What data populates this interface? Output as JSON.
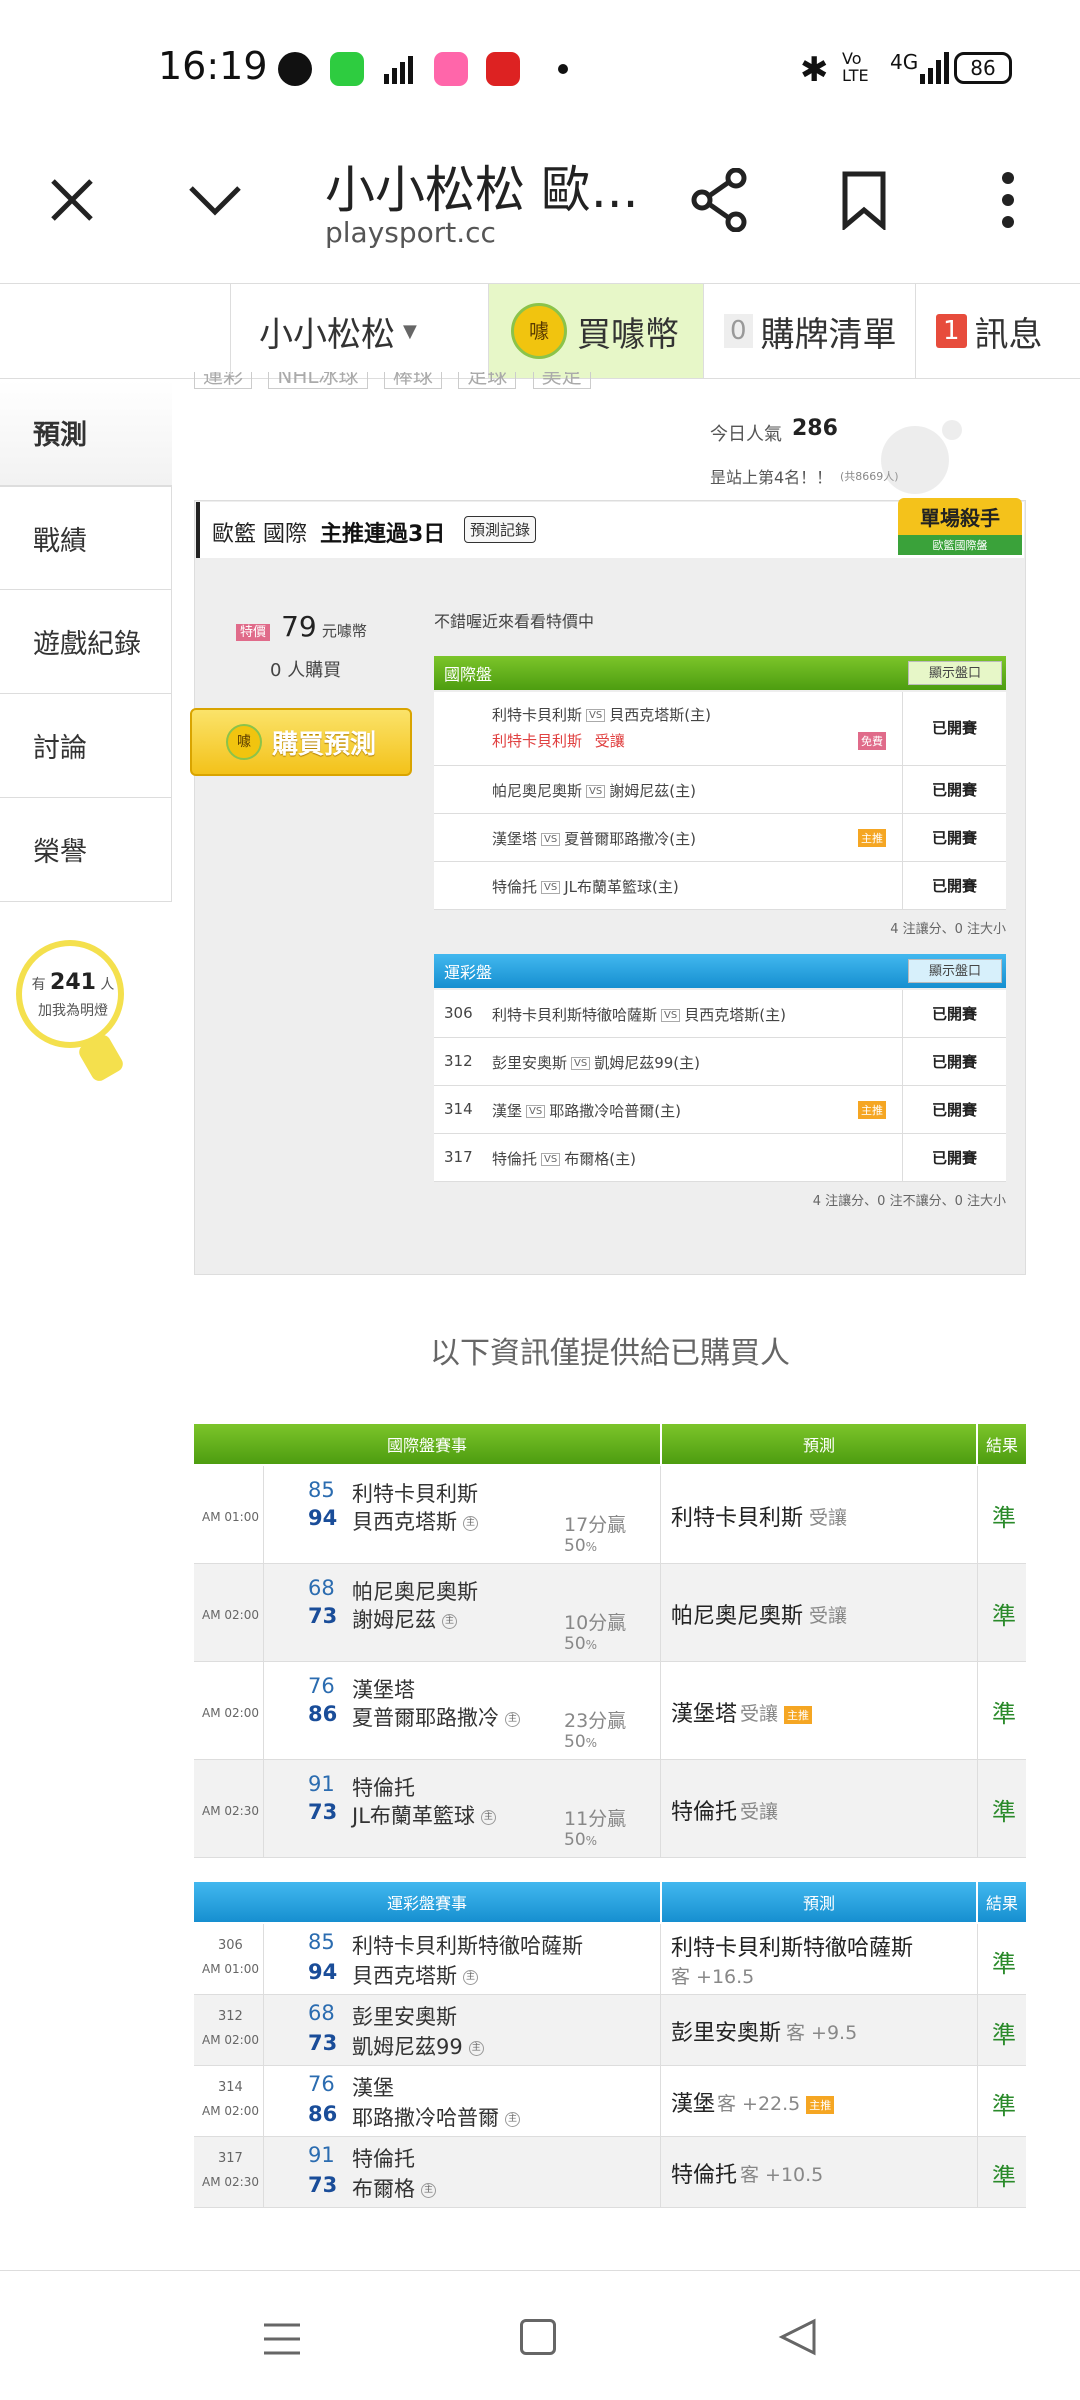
{
  "status_bar": {
    "time": "16:19",
    "battery": "86",
    "net": "4G",
    "lte": "Vo LTE"
  },
  "browser": {
    "title": "小小松松 歐...",
    "url": "playsport.cc"
  },
  "site_nav": {
    "user": "小小松松",
    "buy_coins": "買噱幣",
    "buy_count": "0",
    "buy_list": "購牌清單",
    "msg_count": "1",
    "msg": "訊息",
    "coin_icon": "噱"
  },
  "left_menu": {
    "items": [
      "預測",
      "戰績",
      "遊戲紀錄",
      "討論",
      "榮譽"
    ],
    "fans_prefix": "有",
    "fans_count": "241",
    "fans_suffix": "人",
    "fans_note": "加我為明燈"
  },
  "top_tabs": [
    "運彩",
    "NHL冰球",
    "棒球",
    "足球",
    "美足"
  ],
  "popularity": {
    "label": "今日人氣",
    "value": "286",
    "rank_text": "昰站上第4名！！",
    "rank_note": "(共8669人)"
  },
  "killer_badge": {
    "title": "單場殺手",
    "sub": "歐籃國際盤"
  },
  "panel": {
    "title_pre": "歐籃 國際",
    "title_bold": "主推連過3日",
    "record_btn": "預測記錄",
    "price_tag": "特價",
    "price": "79",
    "price_unit": "元噱幣",
    "buyers": "0",
    "buyers_unit": "人購買",
    "buy_btn": "購買預測",
    "promo": "不錯喔近來看看特價中",
    "intl_header": "國際盤",
    "show_btn": "顯示盤口",
    "vs": "VS",
    "closed": "已開賽",
    "free": "免費",
    "main_tag": "主推",
    "intl_rows": [
      {
        "a": "利特卡貝利斯",
        "b": "貝西克塔斯(主)",
        "pick": "利特卡貝利斯",
        "pick_note": "受讓"
      },
      {
        "a": "帕尼奧尼奧斯",
        "b": "謝姆尼茲(主)"
      },
      {
        "a": "漢堡塔",
        "b": "夏普爾耶路撒冷(主)"
      },
      {
        "a": "特倫托",
        "b": "JL布蘭革籃球(主)"
      }
    ],
    "intl_summary": "4 注讓分、0 注大小",
    "lottery_header": "運彩盤",
    "lottery_rows": [
      {
        "no": "306",
        "a": "利特卡貝利斯特徹哈薩斯",
        "b": "貝西克塔斯(主)"
      },
      {
        "no": "312",
        "a": "彭里安奧斯",
        "b": "凱姆尼茲99(主)"
      },
      {
        "no": "314",
        "a": "漢堡",
        "b": "耶路撒冷哈普爾(主)"
      },
      {
        "no": "317",
        "a": "特倫托",
        "b": "布爾格(主)"
      }
    ],
    "lottery_summary": "4 注讓分、0 注不讓分、0 注大小"
  },
  "info_note": "以下資訊僅提供給已購買人",
  "intl_table": {
    "h1": "國際盤賽事",
    "h2": "預測",
    "h3": "結果",
    "home": "主",
    "rows": [
      {
        "time": "AM 01:00",
        "s1": "85",
        "s2": "94",
        "t1": "利特卡貝利斯",
        "t2": "貝西克塔斯",
        "margin": "17分贏",
        "pct": "50",
        "pct_unit": "%",
        "pred": "利特卡貝利斯",
        "note": "受讓",
        "tag": "",
        "res": "準"
      },
      {
        "time": "AM 02:00",
        "s1": "68",
        "s2": "73",
        "t1": "帕尼奧尼奧斯",
        "t2": "謝姆尼茲",
        "margin": "10分贏",
        "pct": "50",
        "pct_unit": "%",
        "pred": "帕尼奧尼奧斯",
        "note": "受讓",
        "tag": "",
        "res": "準"
      },
      {
        "time": "AM 02:00",
        "s1": "76",
        "s2": "86",
        "t1": "漢堡塔",
        "t2": "夏普爾耶路撒冷",
        "margin": "23分贏",
        "pct": "50",
        "pct_unit": "%",
        "pred": "漢堡塔",
        "note": "受讓",
        "tag": "主推",
        "res": "準"
      },
      {
        "time": "AM 02:30",
        "s1": "91",
        "s2": "73",
        "t1": "特倫托",
        "t2": "JL布蘭革籃球",
        "margin": "11分贏",
        "pct": "50",
        "pct_unit": "%",
        "pred": "特倫托",
        "note": "受讓",
        "tag": "",
        "res": "準"
      }
    ]
  },
  "lottery_table": {
    "h1": "運彩盤賽事",
    "h2": "預測",
    "h3": "結果",
    "home": "主",
    "rows": [
      {
        "no": "306",
        "time": "AM 01:00",
        "s1": "85",
        "s2": "94",
        "t1": "利特卡貝利斯特徹哈薩斯",
        "t2": "貝西克塔斯",
        "pred": "利特卡貝利斯特徹哈薩斯",
        "note": "客 +16.5",
        "tag": "",
        "res": "準"
      },
      {
        "no": "312",
        "time": "AM 02:00",
        "s1": "68",
        "s2": "73",
        "t1": "彭里安奧斯",
        "t2": "凱姆尼茲99",
        "pred": "彭里安奧斯",
        "note": "客 +9.5",
        "tag": "",
        "res": "準"
      },
      {
        "no": "314",
        "time": "AM 02:00",
        "s1": "76",
        "s2": "86",
        "t1": "漢堡",
        "t2": "耶路撒冷哈普爾",
        "pred": "漢堡",
        "note": "客 +22.5",
        "tag": "主推",
        "res": "準"
      },
      {
        "no": "317",
        "time": "AM 02:30",
        "s1": "91",
        "s2": "73",
        "t1": "特倫托",
        "t2": "布爾格",
        "pred": "特倫托",
        "note": "客 +10.5",
        "tag": "",
        "res": "準"
      }
    ]
  }
}
